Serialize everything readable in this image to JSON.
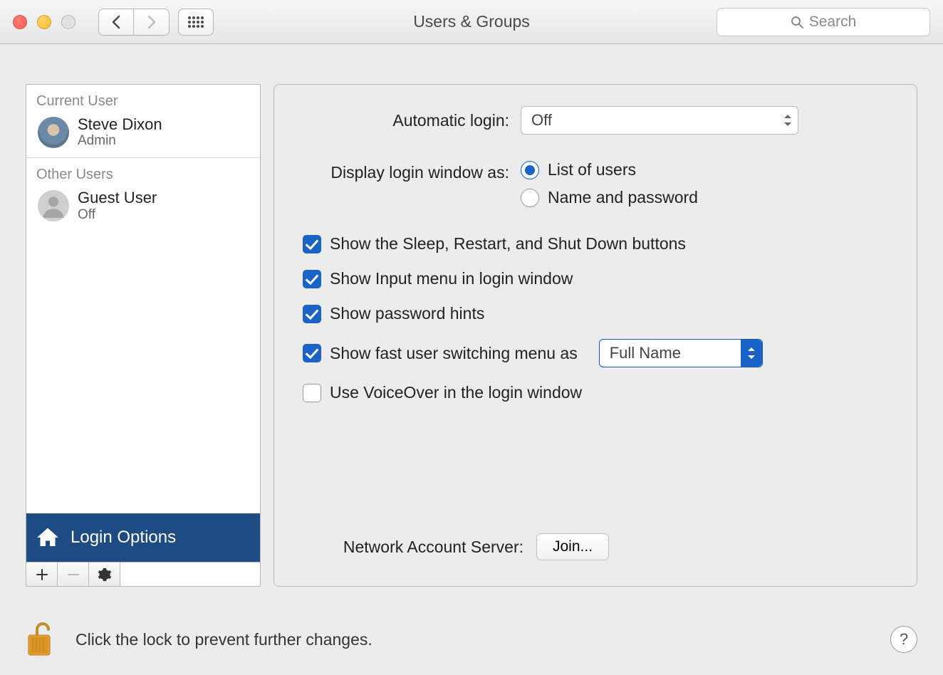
{
  "window": {
    "title": "Users & Groups"
  },
  "toolbar": {
    "search_placeholder": "Search"
  },
  "sidebar": {
    "current_header": "Current User",
    "other_header": "Other Users",
    "current_user": {
      "name": "Steve Dixon",
      "role": "Admin"
    },
    "other_users": [
      {
        "name": "Guest User",
        "status": "Off"
      }
    ],
    "login_options_label": "Login Options"
  },
  "pane": {
    "automatic_login_label": "Automatic login:",
    "automatic_login_value": "Off",
    "display_login_label": "Display login window as:",
    "radio_list_label": "List of users",
    "radio_name_label": "Name and password",
    "cb_sleep_label": "Show the Sleep, Restart, and Shut Down buttons",
    "cb_input_label": "Show Input menu in login window",
    "cb_hints_label": "Show password hints",
    "cb_fast_label": "Show fast user switching menu as",
    "fast_switch_value": "Full Name",
    "cb_voiceover_label": "Use VoiceOver in the login window",
    "network_server_label": "Network Account Server:",
    "join_label": "Join..."
  },
  "footer": {
    "lock_text": "Click the lock to prevent further changes."
  }
}
